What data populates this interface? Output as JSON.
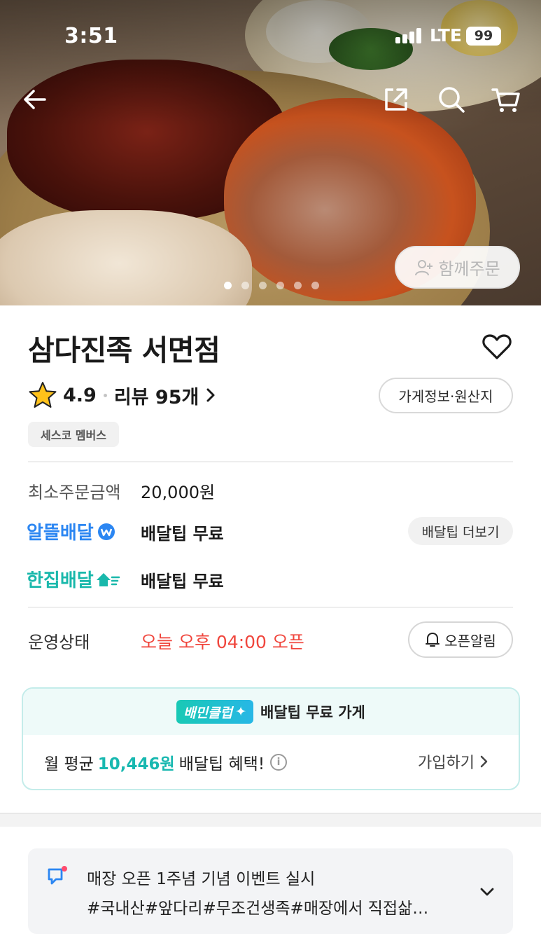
{
  "status_bar": {
    "time": "3:51",
    "network": "LTE",
    "battery": "99"
  },
  "hero": {
    "carousel_total": 6,
    "carousel_active": 1,
    "group_order_label": "함께주문"
  },
  "store": {
    "name": "삼다진족 서면점",
    "rating": "4.9",
    "review_label": "리뷰 95개",
    "info_button": "가게정보·원산지",
    "tag": "세스코 멤버스"
  },
  "order_info": {
    "min_order_label": "최소주문금액",
    "min_order_value": "20,000원",
    "delivery_rows": [
      {
        "brand": "알뜰배달",
        "tip": "배달팁 무료"
      },
      {
        "brand": "한집배달",
        "tip": "배달팁 무료"
      }
    ],
    "tip_more_button": "배달팁 더보기"
  },
  "operation": {
    "label": "운영상태",
    "status": "오늘 오후 04:00 오픈",
    "alarm_button": "오픈알림"
  },
  "club": {
    "badge": "배민클럽",
    "headline": "배달팁 무료 가게",
    "text_prefix": "월 평균",
    "amount": "10,446원",
    "text_suffix": "배달팁 혜택!",
    "join_label": "가입하기"
  },
  "notice": {
    "line1": "매장 오픈 1주념 기념 이벤트 실시",
    "line2": "#국내산#앞다리#무조건생족#매장에서 직접삶…"
  },
  "colors": {
    "accent_blue": "#2b86f2",
    "accent_teal": "#19b8ab",
    "open_status_red": "#f0463d",
    "club_amount": "#18b8b0"
  }
}
